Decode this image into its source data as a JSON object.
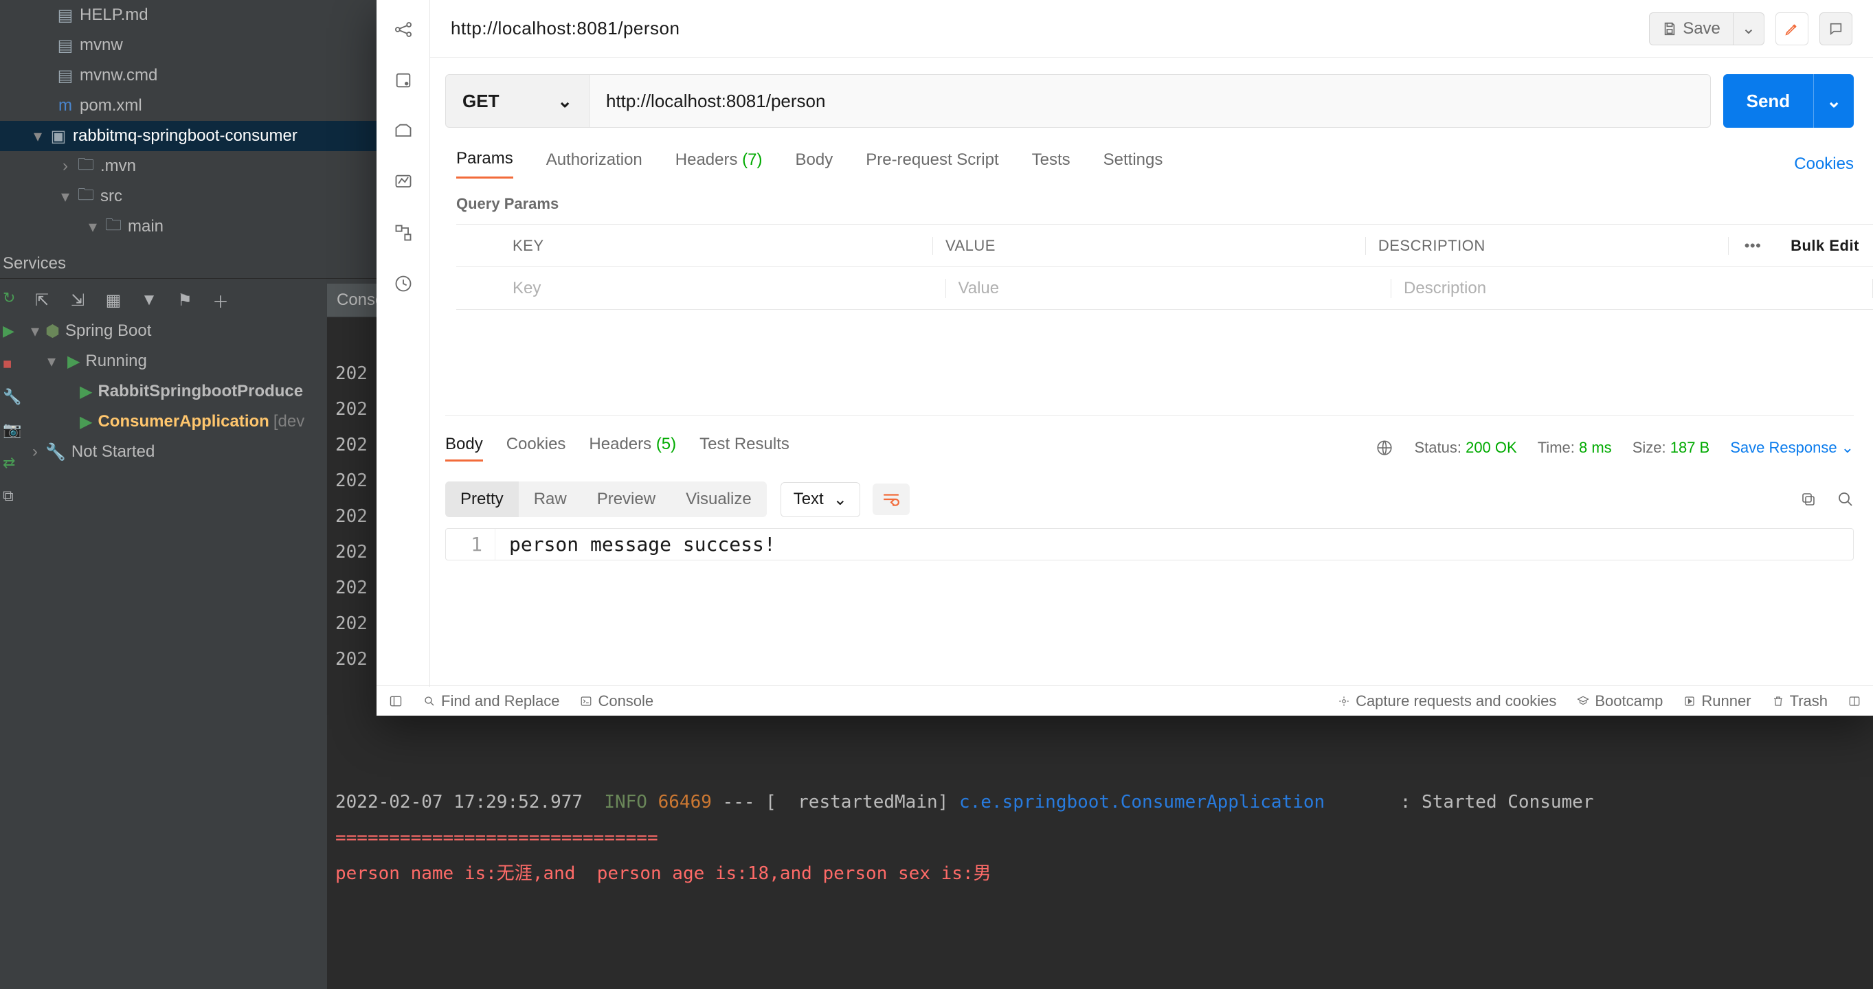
{
  "ide": {
    "tree": [
      {
        "indent": 0,
        "icon": "file",
        "label": "HELP.md"
      },
      {
        "indent": 0,
        "icon": "file",
        "label": "mvnw"
      },
      {
        "indent": 0,
        "icon": "file",
        "label": "mvnw.cmd"
      },
      {
        "indent": 0,
        "icon": "maven",
        "label": "pom.xml"
      }
    ],
    "project": {
      "chevron": "▾",
      "label": "rabbitmq-springboot-consumer"
    },
    "sub": [
      {
        "indent": 2,
        "chevron": "›",
        "icon": "folder",
        "label": ".mvn"
      },
      {
        "indent": 2,
        "chevron": "▾",
        "icon": "folder",
        "label": "src"
      },
      {
        "indent": 3,
        "chevron": "▾",
        "icon": "folder",
        "label": "main"
      }
    ],
    "services_title": "Services",
    "console_tab": "Conso",
    "run": {
      "root": "Spring Boot",
      "running": "Running",
      "items": [
        {
          "label": "RabbitSpringbootProduce",
          "highlight": false
        },
        {
          "label": "ConsumerApplication",
          "suffix": "[dev",
          "highlight": true
        }
      ],
      "not_started": "Not Started"
    }
  },
  "postman": {
    "title": "http://localhost:8081/person",
    "save_label": "Save",
    "method": "GET",
    "url": "http://localhost:8081/person",
    "send_label": "Send",
    "req_tabs": {
      "params": "Params",
      "auth": "Authorization",
      "headers": "Headers",
      "headers_count": "(7)",
      "body": "Body",
      "prereq": "Pre-request Script",
      "tests": "Tests",
      "settings": "Settings",
      "cookies": "Cookies"
    },
    "query_params_label": "Query Params",
    "table": {
      "key_h": "KEY",
      "val_h": "VALUE",
      "desc_h": "DESCRIPTION",
      "bulk": "Bulk Edit",
      "key_ph": "Key",
      "val_ph": "Value",
      "desc_ph": "Description"
    },
    "resp": {
      "tabs": {
        "body": "Body",
        "cookies": "Cookies",
        "headers": "Headers",
        "headers_count": "(5)",
        "tests": "Test Results"
      },
      "status_lbl": "Status:",
      "status_val": "200 OK",
      "time_lbl": "Time:",
      "time_val": "8 ms",
      "size_lbl": "Size:",
      "size_val": "187 B",
      "save": "Save Response",
      "formats": {
        "pretty": "Pretty",
        "raw": "Raw",
        "preview": "Preview",
        "visualize": "Visualize"
      },
      "type": "Text",
      "line_no": "1",
      "body_text": "person message success!"
    },
    "footer": {
      "find": "Find and Replace",
      "console": "Console",
      "capture": "Capture requests and cookies",
      "bootcamp": "Bootcamp",
      "runner": "Runner",
      "trash": "Trash"
    }
  },
  "console": {
    "gutter_prefix": "202",
    "line1": {
      "ts": "2022-02-07 17:29:52.977",
      "info": "INFO",
      "pid": "66469",
      "sep": " --- [  restartedMain] ",
      "logger": "c.e.springboot.ConsumerApplication",
      "tail": "       : Started Consumer"
    },
    "eqline": "==============================",
    "line2": "person name is:无涯,and  person age is:18,and person sex is:男"
  }
}
